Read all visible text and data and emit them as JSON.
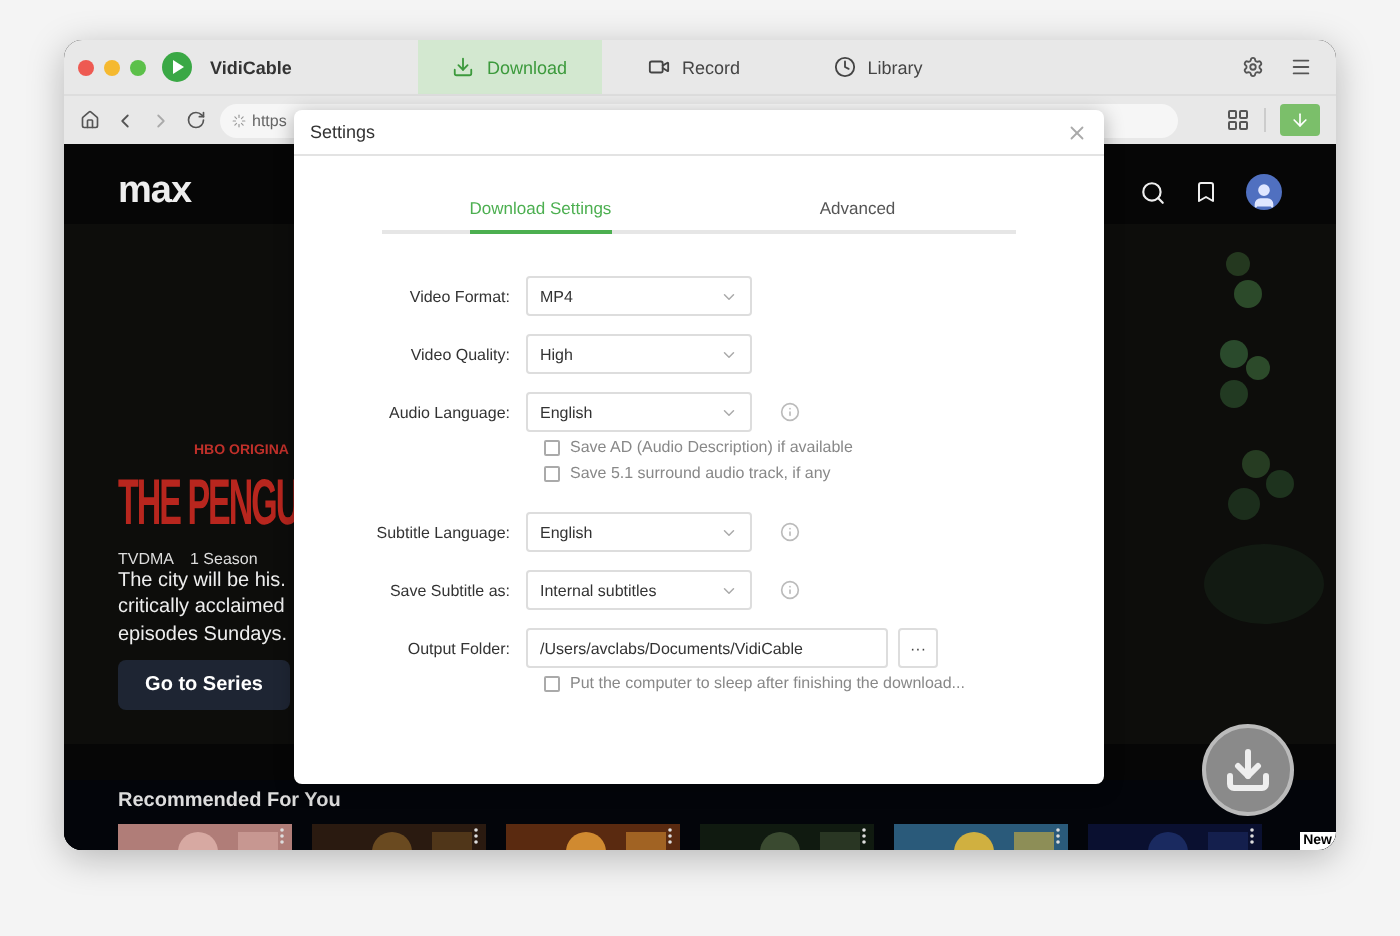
{
  "window": {
    "app_name": "VidiCable"
  },
  "tabs": [
    {
      "kind": "download",
      "label": "Download",
      "selected": true
    },
    {
      "kind": "record",
      "label": "Record",
      "selected": false
    },
    {
      "kind": "library",
      "label": "Library",
      "selected": false
    }
  ],
  "address_bar": {
    "url": "https"
  },
  "site": {
    "logo": "max",
    "hero": {
      "badge": "HBO ORIGINA",
      "title": "THE PENGU",
      "rating": "TVDMA",
      "seasons": "1 Season",
      "description_lines": [
        "The city will be his.",
        "critically acclaimed",
        "episodes Sundays."
      ],
      "cta": "Go to Series"
    },
    "section_title": "Recommended For You",
    "new_badge": "New"
  },
  "dialog": {
    "title": "Settings",
    "tabs": [
      {
        "label": "Download Settings",
        "selected": true
      },
      {
        "label": "Advanced",
        "selected": false
      }
    ],
    "fields": [
      {
        "kind": "select",
        "label": "Video Format:",
        "value": "MP4",
        "info": false
      },
      {
        "kind": "select",
        "label": "Video Quality:",
        "value": "High",
        "info": false
      },
      {
        "kind": "select",
        "label": "Audio Language:",
        "value": "English",
        "info": true
      },
      {
        "kind": "checkbox",
        "label": "Save AD (Audio Description) if available",
        "checked": false
      },
      {
        "kind": "checkbox",
        "label": "Save 5.1 surround audio track, if any",
        "checked": false
      },
      {
        "kind": "select",
        "label": "Subtitle Language:",
        "value": "English",
        "info": true
      },
      {
        "kind": "select",
        "label": "Save Subtitle as:",
        "value": "Internal subtitles",
        "info": true
      },
      {
        "kind": "folder",
        "label": "Output Folder:",
        "value": "/Users/avclabs/Documents/VidiCable",
        "button": "···"
      },
      {
        "kind": "checkbox",
        "label": "Put the computer to sleep after finishing the download...",
        "checked": false
      }
    ]
  }
}
